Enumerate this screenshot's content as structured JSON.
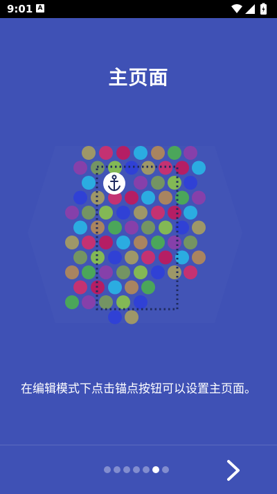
{
  "status_bar": {
    "time": "9:01",
    "notification_icon": "a-icon"
  },
  "page": {
    "title": "主页面",
    "description": "在编辑模式下点击锚点按钮可以设置主页面。"
  },
  "illustration": {
    "anchor_icon": "anchor-icon"
  },
  "pager": {
    "total": 7,
    "active_index": 5
  },
  "navigation": {
    "next_icon": "chevron-right-icon"
  }
}
